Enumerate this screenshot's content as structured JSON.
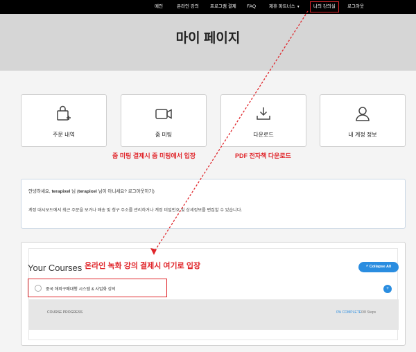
{
  "nav": {
    "items": [
      "메인",
      "온라인 강의",
      "프로그램 결제",
      "FAQ",
      "제휴 파트너스",
      "나의 강의실",
      "로그아웃"
    ],
    "active": "나의 강의실",
    "dropdown_arrow": "▼"
  },
  "hero": {
    "title": "마이 페이지"
  },
  "cards": [
    {
      "label": "주문 내역",
      "icon": "shopping-bag-icon"
    },
    {
      "label": "줌 미팅",
      "icon": "video-camera-icon"
    },
    {
      "label": "다운로드",
      "icon": "download-icon"
    },
    {
      "label": "내 계정 정보",
      "icon": "user-icon"
    }
  ],
  "annotations": {
    "zoom": "줌 미팅 결제시 줌 미팅에서 입장",
    "pdf": "PDF 전자책 다운로드",
    "courses": "온라인 녹화 강의 결제시 여기로 입장"
  },
  "welcome": {
    "greeting_prefix": "안녕하세요, ",
    "username": "terapixel",
    "greeting_mid": " 님 (",
    "username2": "terapixel",
    "greeting_suffix": " 님이 아니세요? 로그아웃하기)",
    "description": "계정 대시보드에서 최근 주문을 보거나 배송 및 청구 주소를 관리하거나 계정 비밀번호 및 상세정보를 편집할 수 있습니다."
  },
  "courses": {
    "title": "Your Courses",
    "collapse_label": "^ Collapse All",
    "course_name": "중국 해외구매대행 시스템 & 사업화 강의",
    "progress_label": "COURSE PROGRESS",
    "status": "0% COMPLETE",
    "steps": "0/8 Steps",
    "toggle_symbol": "+"
  },
  "colors": {
    "accent_red": "#e0262b",
    "accent_blue": "#2a8de0",
    "hero_bg": "#d6d6d6",
    "topbar_bg": "#000000"
  }
}
